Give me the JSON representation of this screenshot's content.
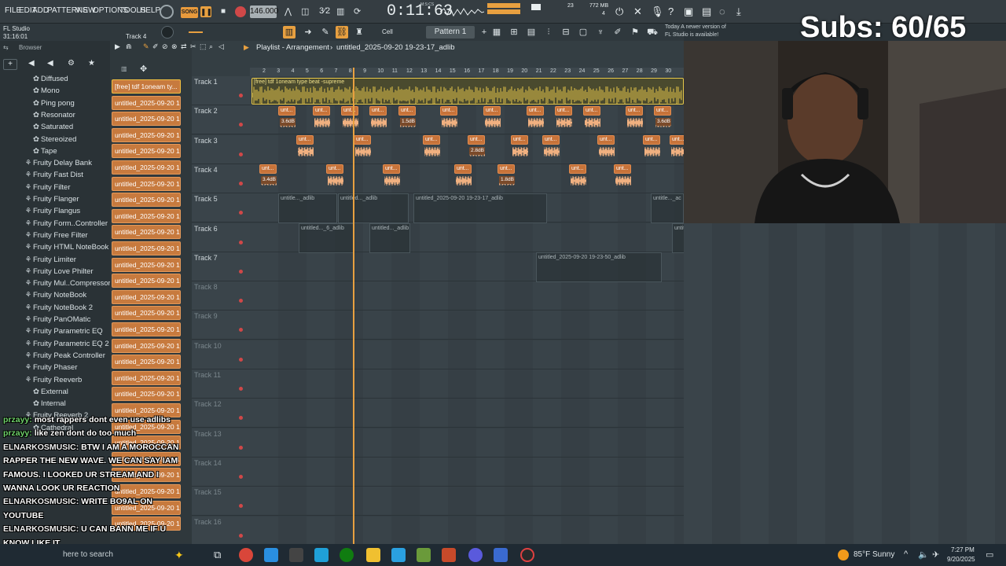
{
  "menus": [
    "FILE",
    "EDIT",
    "ADD",
    "PATTERNS",
    "VIEW",
    "OPTIONS",
    "TOOLS",
    "HELP"
  ],
  "song_mode": "SONG",
  "tempo": "146.000",
  "time_display": "0:11:63",
  "time_unit": "M:S:CS",
  "cpu": "23",
  "memory": "772 MB",
  "voices": "4",
  "app_name": "FL Studio",
  "position": "31:16:01",
  "hint_track": "Track 4",
  "snap": "Cell",
  "pattern": "Pattern 1",
  "news": [
    "Today  A newer version of",
    "FL Studio is available!"
  ],
  "browser_label": "Browser",
  "playlist_title": "Playlist - Arrangement",
  "playlist_file": "untitled_2025-09-20 19-23-17_adlib",
  "subs": "Subs: 60/65",
  "browser_items": [
    {
      "label": "Diffused",
      "indent": 2
    },
    {
      "label": "Mono",
      "indent": 2
    },
    {
      "label": "Ping pong",
      "indent": 2
    },
    {
      "label": "Resonator",
      "indent": 2
    },
    {
      "label": "Saturated",
      "indent": 2
    },
    {
      "label": "Stereoized",
      "indent": 2
    },
    {
      "label": "Tape",
      "indent": 2
    },
    {
      "label": "Fruity Delay Bank",
      "indent": 1
    },
    {
      "label": "Fruity Fast Dist",
      "indent": 1
    },
    {
      "label": "Fruity Filter",
      "indent": 1
    },
    {
      "label": "Fruity Flanger",
      "indent": 1
    },
    {
      "label": "Fruity Flangus",
      "indent": 1
    },
    {
      "label": "Fruity Form..Controller",
      "indent": 1
    },
    {
      "label": "Fruity Free Filter",
      "indent": 1
    },
    {
      "label": "Fruity HTML NoteBook",
      "indent": 1
    },
    {
      "label": "Fruity Limiter",
      "indent": 1
    },
    {
      "label": "Fruity Love Philter",
      "indent": 1
    },
    {
      "label": "Fruity Mul..Compressor",
      "indent": 1
    },
    {
      "label": "Fruity NoteBook",
      "indent": 1
    },
    {
      "label": "Fruity NoteBook 2",
      "indent": 1
    },
    {
      "label": "Fruity PanOMatic",
      "indent": 1
    },
    {
      "label": "Fruity Parametric EQ",
      "indent": 1
    },
    {
      "label": "Fruity Parametric EQ 2",
      "indent": 1
    },
    {
      "label": "Fruity Peak Controller",
      "indent": 1
    },
    {
      "label": "Fruity Phaser",
      "indent": 1
    },
    {
      "label": "Fruity Reeverb",
      "indent": 1
    },
    {
      "label": "External",
      "indent": 2
    },
    {
      "label": "Internal",
      "indent": 2
    },
    {
      "label": "Fruity Reeverb 2",
      "indent": 1
    },
    {
      "label": "Cathedral",
      "indent": 2
    }
  ],
  "channel_first": "[free] tdf  1oneam ty...",
  "channel_other": "untitled_2025-09-20 18-",
  "tracks": [
    "Track 1",
    "Track 2",
    "Track 3",
    "Track 4",
    "Track 5",
    "Track 6",
    "Track 7",
    "Track 8",
    "Track 9",
    "Track 10",
    "Track 11",
    "Track 12",
    "Track 13",
    "Track 14",
    "Track 15",
    "Track 16"
  ],
  "track1_clip": "[free] tdf  1oneam type beat -supreme",
  "gain_labels": [
    "3.6dB",
    "1.5dB",
    "3.6dB",
    "2.8dB",
    "3.4dB",
    "1.8dB"
  ],
  "clip_short": "unt...",
  "track5_clips": [
    "untitle..._adlib",
    "untitled..._adlib",
    "untitled_2025-09-20 19-23-17_adlib",
    "untitle..._ac"
  ],
  "track6_clips": [
    "untitled..._6_adlib",
    "untitled..._adlib",
    "untitled..._6_adlib",
    "untitle..._adlib"
  ],
  "track7_clip": "untitled_2025-09-20 19-23-50_adlib",
  "ruler_marks": [
    "2",
    "3",
    "4",
    "5",
    "6",
    "7",
    "8",
    "9",
    "10",
    "11",
    "12",
    "13",
    "14",
    "15",
    "16",
    "17",
    "18",
    "19",
    "20",
    "21",
    "22",
    "23",
    "24",
    "25",
    "26",
    "27",
    "28",
    "29",
    "30"
  ],
  "chat": [
    {
      "user": "przayy:",
      "msg": "most rappers dont even use adlibs",
      "color": "green"
    },
    {
      "user": "przayy:",
      "msg": "like zen dont do too much",
      "color": "green"
    },
    {
      "user": "ELNARKOSMUSIC:",
      "msg": "BTW I AM A MOROCCAN",
      "color": "white"
    },
    {
      "user": "",
      "msg": "RAPPER THE NEW WAVE. WE CAN SAY IAM",
      "color": "white"
    },
    {
      "user": "",
      "msg": "FAMOUS. I LOOKED UR STREAM AND I",
      "color": "white"
    },
    {
      "user": "",
      "msg": "WANNA LOOK UR REACTION",
      "color": "white"
    },
    {
      "user": "ELNARKOSMUSIC:",
      "msg": "WRITE BO9AL ON",
      "color": "white"
    },
    {
      "user": "",
      "msg": "YOUTUBE",
      "color": "white"
    },
    {
      "user": "ELNARKOSMUSIC:",
      "msg": "U CAN BANN ME IF U",
      "color": "white"
    },
    {
      "user": "",
      "msg": "KNOW LIKE IT",
      "color": "white"
    }
  ],
  "taskbar": {
    "search": "here to search",
    "weather": "85°F  Sunny",
    "time": "7:27 PM",
    "date": "9/20/2025"
  },
  "colors": {
    "clip_orange": "#c7733a",
    "audio_yellow": "#e6c74a",
    "record_red": "#d04848",
    "playhead": "#e8a040"
  }
}
